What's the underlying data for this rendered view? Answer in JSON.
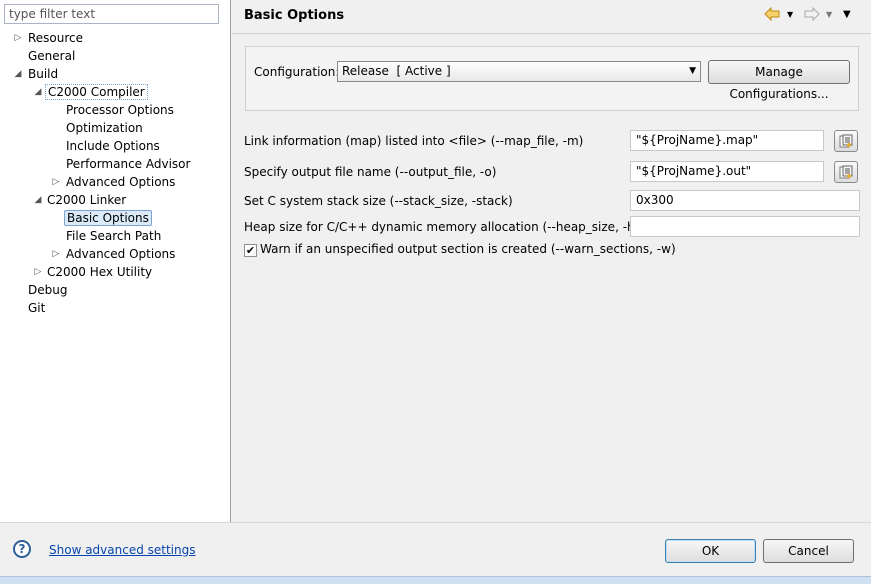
{
  "filter": {
    "placeholder": "type filter text"
  },
  "tree": [
    {
      "label": "Resource",
      "level": 0,
      "twisty": "collapsed"
    },
    {
      "label": "General",
      "level": 0,
      "twisty": "none"
    },
    {
      "label": "Build",
      "level": 0,
      "twisty": "expanded"
    },
    {
      "label": "C2000 Compiler",
      "level": 1,
      "twisty": "expanded",
      "focused": true
    },
    {
      "label": "Processor Options",
      "level": 2,
      "twisty": "none"
    },
    {
      "label": "Optimization",
      "level": 2,
      "twisty": "none"
    },
    {
      "label": "Include Options",
      "level": 2,
      "twisty": "none"
    },
    {
      "label": "Performance Advisor",
      "level": 2,
      "twisty": "none"
    },
    {
      "label": "Advanced Options",
      "level": 2,
      "twisty": "collapsed"
    },
    {
      "label": "C2000 Linker",
      "level": 1,
      "twisty": "expanded"
    },
    {
      "label": "Basic Options",
      "level": 2,
      "twisty": "none",
      "selected": true
    },
    {
      "label": "File Search Path",
      "level": 2,
      "twisty": "none"
    },
    {
      "label": "Advanced Options",
      "level": 2,
      "twisty": "collapsed"
    },
    {
      "label": "C2000 Hex Utility",
      "level": 1,
      "twisty": "collapsed"
    },
    {
      "label": "Debug",
      "level": 0,
      "twisty": "none"
    },
    {
      "label": "Git",
      "level": 0,
      "twisty": "none"
    }
  ],
  "header": {
    "title": "Basic Options"
  },
  "config": {
    "label": "Configuration:",
    "value": "Release  [ Active ]",
    "manage_label": "Manage Configurations..."
  },
  "options": {
    "map_file": {
      "label": "Link information (map) listed into <file> (--map_file, -m)",
      "value": "\"${ProjName}.map\""
    },
    "output_file": {
      "label": "Specify output file name (--output_file, -o)",
      "value": "\"${ProjName}.out\""
    },
    "stack_size": {
      "label": "Set C system stack size (--stack_size, -stack)",
      "value": "0x300"
    },
    "heap_size": {
      "label": "Heap size for C/C++ dynamic memory allocation (--heap_size, -heap)",
      "value": ""
    },
    "warn_sections": {
      "label": "Warn if an unspecified output section is created (--warn_sections, -w)",
      "checked": true
    }
  },
  "footer": {
    "help_glyph": "?",
    "advanced_link": "Show advanced settings",
    "ok_label": "OK",
    "cancel_label": "Cancel"
  },
  "icons": {
    "back": "back-arrow-icon",
    "forward": "forward-arrow-icon",
    "menu": "view-menu-icon",
    "variables": "insert-variable-icon",
    "help": "help-icon"
  },
  "colors": {
    "link": "#0645ad",
    "back_arrow": "#d9a21b",
    "selection": "#dbeaf8"
  }
}
